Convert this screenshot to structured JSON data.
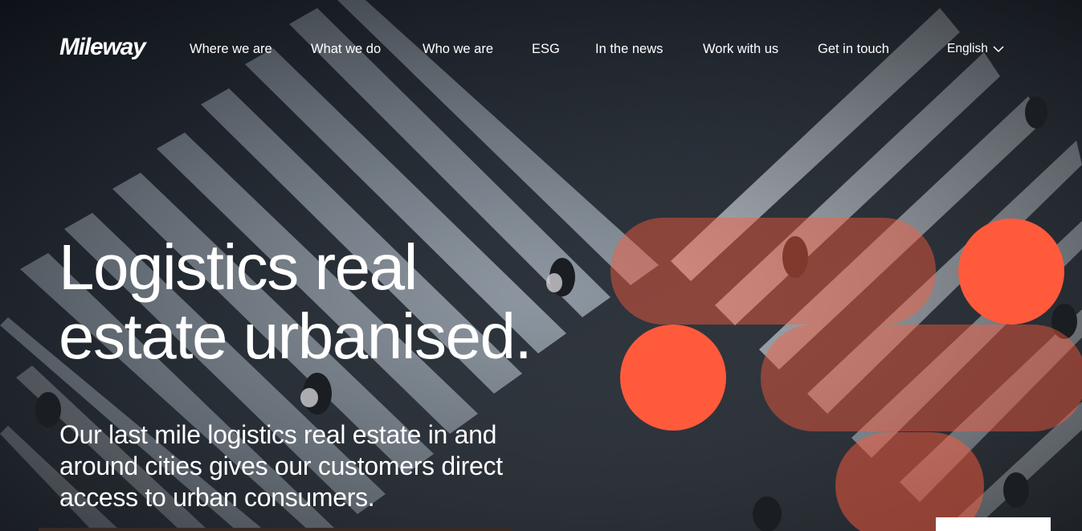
{
  "brand": {
    "logo_text": "Mileway",
    "accent_color": "#ff5a3c"
  },
  "nav": {
    "items": [
      {
        "label": "Where we are"
      },
      {
        "label": "What we do"
      },
      {
        "label": "Who we are"
      },
      {
        "label": "ESG"
      },
      {
        "label": "In the news"
      },
      {
        "label": "Work with us"
      },
      {
        "label": "Get in touch"
      }
    ],
    "language": {
      "label": "English",
      "icon": "chevron-down-icon"
    }
  },
  "hero": {
    "headline_line1": "Logistics real",
    "headline_line2": "estate urbanised.",
    "subtext": "Our last mile logistics real estate in and around cities gives our customers direct access to urban consumers.",
    "background": "aerial-crosswalk-photo"
  }
}
